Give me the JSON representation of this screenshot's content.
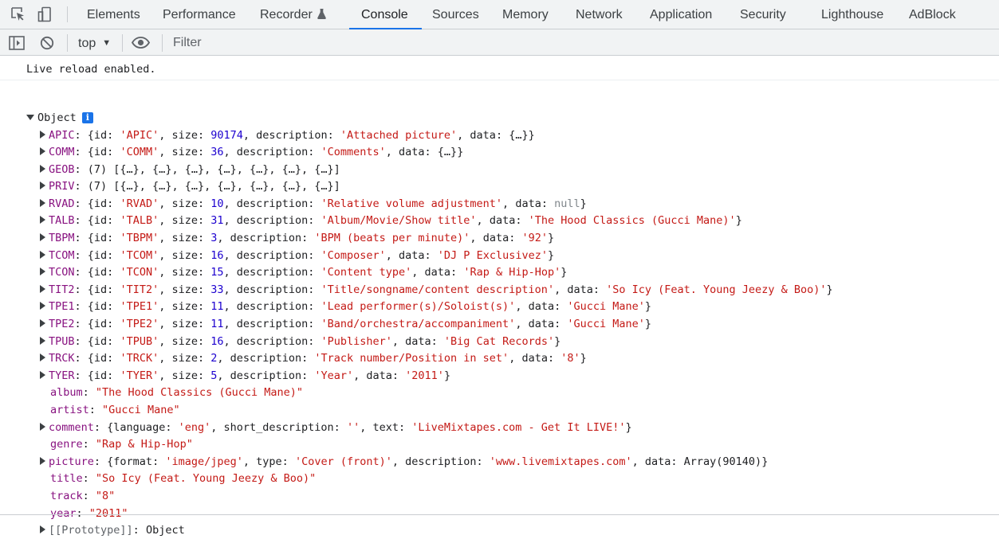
{
  "tabs": [
    {
      "label": "Elements",
      "active": false
    },
    {
      "label": "Performance",
      "active": false
    },
    {
      "label": "Recorder",
      "active": false
    },
    {
      "label": "Console",
      "active": true
    },
    {
      "label": "Sources",
      "active": false
    },
    {
      "label": "Memory",
      "active": false
    },
    {
      "label": "Network",
      "active": false
    },
    {
      "label": "Application",
      "active": false
    },
    {
      "label": "Security",
      "active": false
    },
    {
      "label": "Lighthouse",
      "active": false
    },
    {
      "label": "AdBlock",
      "active": false
    }
  ],
  "toolbar": {
    "context": "top",
    "filter_placeholder": "Filter"
  },
  "icons": {
    "inspect": "inspect-element-icon",
    "device": "device-toggle-icon",
    "recorder": "flask-icon",
    "sidebar": "sidebar-toggle-icon",
    "clear": "clear-console-icon",
    "context_caret": "caret-down-icon",
    "live": "eye-icon",
    "info": "info-icon",
    "expand": "expand-arrow-icon"
  },
  "colors": {
    "accent": "#1a73e8",
    "key": "#881280",
    "string": "#c41a16",
    "number": "#1c00cf",
    "null": "#80868b"
  },
  "console": {
    "message": "Live reload enabled.",
    "object_label": "Object",
    "info_badge": "i",
    "prototype_key": "[[Prototype]]",
    "prototype_value": "Object",
    "frames": [
      {
        "key": "APIC",
        "id": "'APIC'",
        "size": "90174",
        "description": "'Attached picture'",
        "data": "{…}"
      },
      {
        "key": "COMM",
        "id": "'COMM'",
        "size": "36",
        "description": "'Comments'",
        "data": "{…}"
      },
      {
        "key": "GEOB",
        "array": "(7) [{…}, {…}, {…}, {…}, {…}, {…}, {…}]"
      },
      {
        "key": "PRIV",
        "array": "(7) [{…}, {…}, {…}, {…}, {…}, {…}, {…}]"
      },
      {
        "key": "RVAD",
        "id": "'RVAD'",
        "size": "10",
        "description": "'Relative volume adjustment'",
        "data": "null"
      },
      {
        "key": "TALB",
        "id": "'TALB'",
        "size": "31",
        "description": "'Album/Movie/Show title'",
        "data": "'The Hood Classics (Gucci Mane)'"
      },
      {
        "key": "TBPM",
        "id": "'TBPM'",
        "size": "3",
        "description": "'BPM (beats per minute)'",
        "data": "'92'"
      },
      {
        "key": "TCOM",
        "id": "'TCOM'",
        "size": "16",
        "description": "'Composer'",
        "data": "'DJ P Exclusivez'"
      },
      {
        "key": "TCON",
        "id": "'TCON'",
        "size": "15",
        "description": "'Content type'",
        "data": "'Rap & Hip-Hop'"
      },
      {
        "key": "TIT2",
        "id": "'TIT2'",
        "size": "33",
        "description": "'Title/songname/content description'",
        "data": "'So Icy (Feat. Young Jeezy & Boo)'"
      },
      {
        "key": "TPE1",
        "id": "'TPE1'",
        "size": "11",
        "description": "'Lead performer(s)/Soloist(s)'",
        "data": "'Gucci Mane'"
      },
      {
        "key": "TPE2",
        "id": "'TPE2'",
        "size": "11",
        "description": "'Band/orchestra/accompaniment'",
        "data": "'Gucci Mane'"
      },
      {
        "key": "TPUB",
        "id": "'TPUB'",
        "size": "16",
        "description": "'Publisher'",
        "data": "'Big Cat Records'"
      },
      {
        "key": "TRCK",
        "id": "'TRCK'",
        "size": "2",
        "description": "'Track number/Position in set'",
        "data": "'8'"
      },
      {
        "key": "TYER",
        "id": "'TYER'",
        "size": "5",
        "description": "'Year'",
        "data": "'2011'"
      }
    ],
    "album": "\"The Hood Classics (Gucci Mane)\"",
    "artist": "\"Gucci Mane\"",
    "comment": {
      "language": "'eng'",
      "short_description": "''",
      "text": "'LiveMixtapes.com - Get It LIVE!'"
    },
    "genre": "\"Rap & Hip-Hop\"",
    "picture": {
      "format": "'image/jpeg'",
      "type": "'Cover (front)'",
      "description": "'www.livemixtapes.com'",
      "data": "Array(90140)"
    },
    "title": "\"So Icy (Feat. Young Jeezy & Boo)\"",
    "track": "\"8\"",
    "year": "\"2011\"",
    "prop_keys": {
      "album": "album",
      "artist": "artist",
      "comment": "comment",
      "genre": "genre",
      "picture": "picture",
      "title": "title",
      "track": "track",
      "year": "year",
      "id": "id",
      "size": "size",
      "description": "description",
      "data": "data",
      "language": "language",
      "short_description": "short_description",
      "text": "text",
      "format": "format",
      "type": "type"
    }
  }
}
